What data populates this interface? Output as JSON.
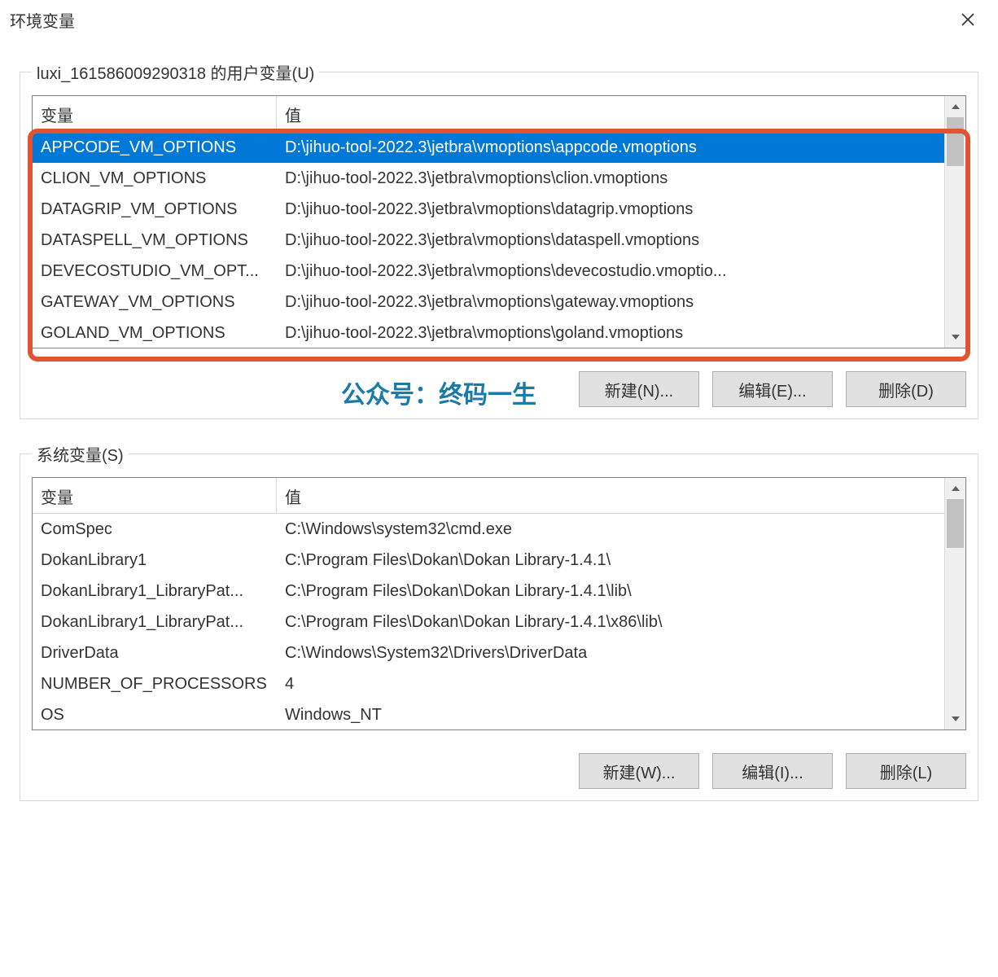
{
  "window_title": "环境变量",
  "user_section_label": "luxi_161586009290318 的用户变量(U)",
  "system_section_label": "系统变量(S)",
  "columns": {
    "variable": "变量",
    "value": "值"
  },
  "user_vars": [
    {
      "name": "APPCODE_VM_OPTIONS",
      "value": "D:\\jihuo-tool-2022.3\\jetbra\\vmoptions\\appcode.vmoptions",
      "selected": true
    },
    {
      "name": "CLION_VM_OPTIONS",
      "value": "D:\\jihuo-tool-2022.3\\jetbra\\vmoptions\\clion.vmoptions"
    },
    {
      "name": "DATAGRIP_VM_OPTIONS",
      "value": "D:\\jihuo-tool-2022.3\\jetbra\\vmoptions\\datagrip.vmoptions"
    },
    {
      "name": "DATASPELL_VM_OPTIONS",
      "value": "D:\\jihuo-tool-2022.3\\jetbra\\vmoptions\\dataspell.vmoptions"
    },
    {
      "name": "DEVECOSTUDIO_VM_OPT...",
      "value": "D:\\jihuo-tool-2022.3\\jetbra\\vmoptions\\devecostudio.vmoptio..."
    },
    {
      "name": "GATEWAY_VM_OPTIONS",
      "value": "D:\\jihuo-tool-2022.3\\jetbra\\vmoptions\\gateway.vmoptions"
    },
    {
      "name": "GOLAND_VM_OPTIONS",
      "value": "D:\\jihuo-tool-2022.3\\jetbra\\vmoptions\\goland.vmoptions"
    }
  ],
  "system_vars": [
    {
      "name": "ComSpec",
      "value": "C:\\Windows\\system32\\cmd.exe"
    },
    {
      "name": "DokanLibrary1",
      "value": "C:\\Program Files\\Dokan\\Dokan Library-1.4.1\\"
    },
    {
      "name": "DokanLibrary1_LibraryPat...",
      "value": "C:\\Program Files\\Dokan\\Dokan Library-1.4.1\\lib\\"
    },
    {
      "name": "DokanLibrary1_LibraryPat...",
      "value": "C:\\Program Files\\Dokan\\Dokan Library-1.4.1\\x86\\lib\\"
    },
    {
      "name": "DriverData",
      "value": "C:\\Windows\\System32\\Drivers\\DriverData"
    },
    {
      "name": "NUMBER_OF_PROCESSORS",
      "value": "4"
    },
    {
      "name": "OS",
      "value": "Windows_NT"
    }
  ],
  "buttons": {
    "user_new": "新建(N)...",
    "user_edit": "编辑(E)...",
    "user_delete": "删除(D)",
    "sys_new": "新建(W)...",
    "sys_edit": "编辑(I)...",
    "sys_delete": "删除(L)"
  },
  "watermark": "公众号：终码一生"
}
